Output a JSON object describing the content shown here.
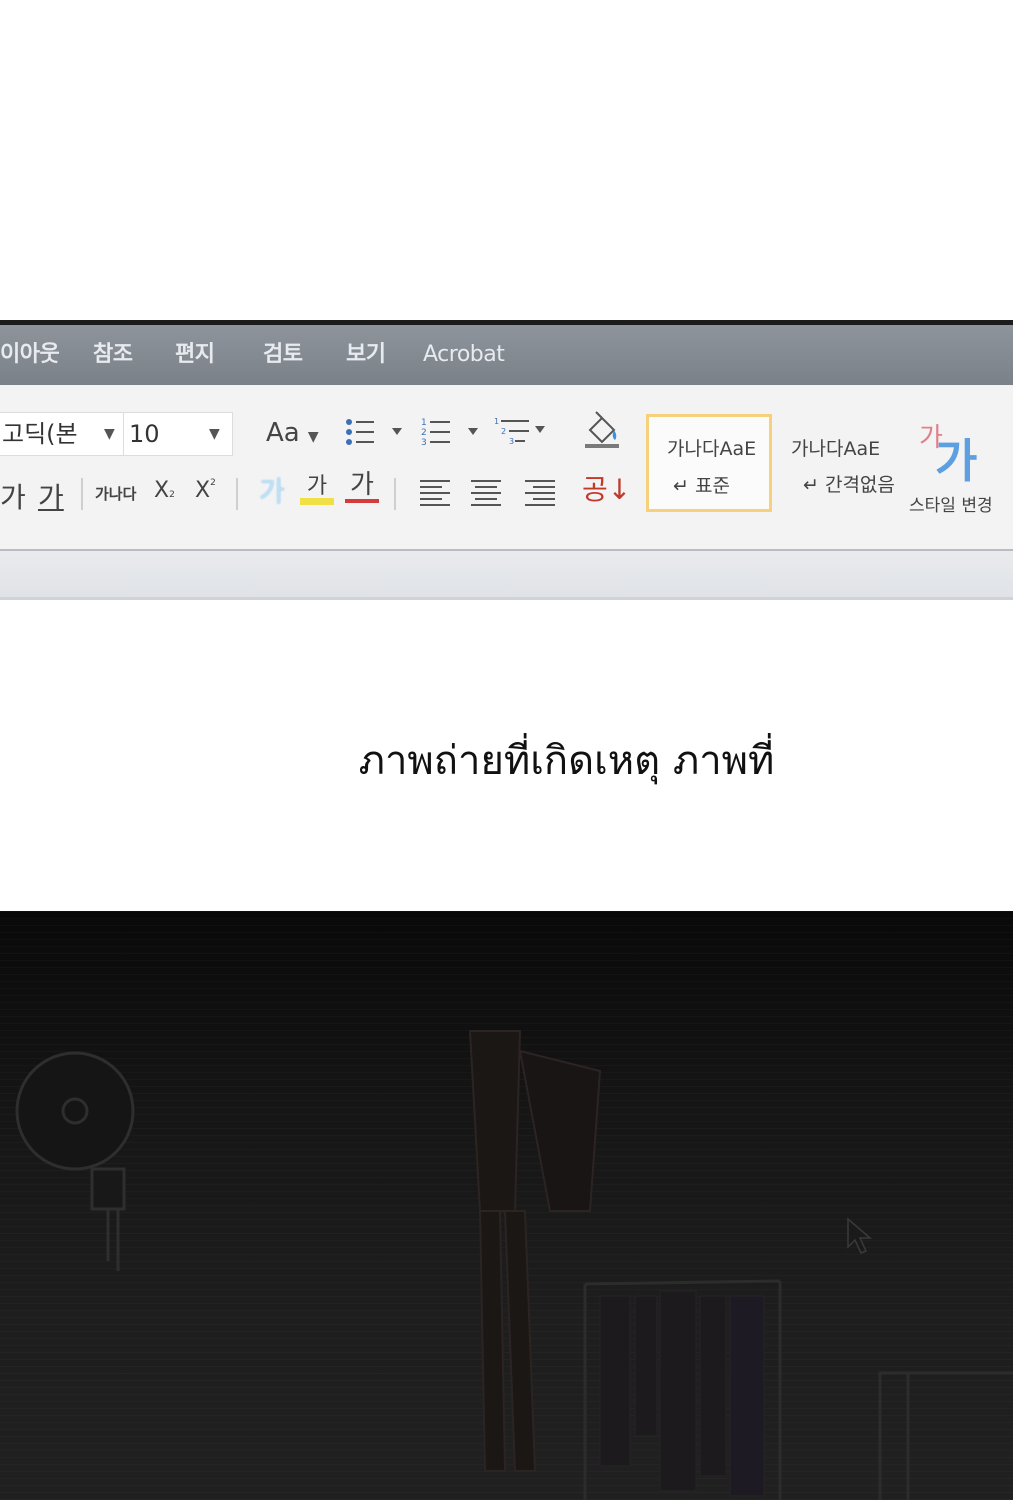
{
  "ribbon": {
    "tabs": [
      "이아웃",
      "참조",
      "편지",
      "검토",
      "보기",
      "Acrobat"
    ],
    "font_name": "고딕(본",
    "font_size": "10",
    "change_case_label": "Aa",
    "hangul_gl1": "가",
    "hangul_gl2": "가",
    "char_spacing_label": "가나다",
    "subscript_label": "X",
    "subscript_mark": "2",
    "superscript_label": "X",
    "superscript_mark": "2",
    "text_effect_label": "가",
    "highlight_label": "가",
    "font_color_label": "가",
    "sort_label": "공↓",
    "styles": [
      {
        "sample": "가나다AaE",
        "name": "↵ 표준",
        "selected": true
      },
      {
        "sample": "가나다AaE",
        "name": "↵ 간격없음",
        "selected": false
      }
    ],
    "change_style_big": "가",
    "change_style_small": "가",
    "change_style_label": "스타일 변경",
    "accent_color": "#f6d07a",
    "highlight_color": "#f0e046",
    "font_color": "#d63b3b"
  },
  "caption": "ภาพถ่ายที่เกิดเหตุ ภาพที่",
  "scene": {
    "description_icons": [
      "wall-fan",
      "hanging-figure",
      "clothes-rack",
      "mouse-cursor",
      "door-frame"
    ]
  }
}
